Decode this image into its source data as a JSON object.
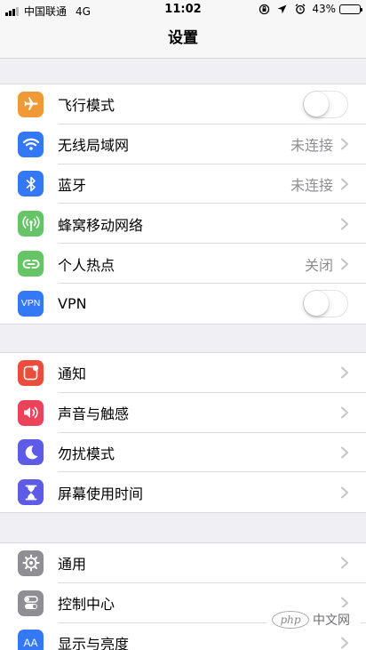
{
  "status_bar": {
    "carrier": "中国联通",
    "network": "4G",
    "time": "11:02",
    "battery_percent": "43%",
    "battery_level": 0.43,
    "icons": [
      "orientation-lock-icon",
      "location-arrow-icon",
      "alarm-clock-icon"
    ]
  },
  "nav": {
    "title": "设置"
  },
  "groups": [
    {
      "items": [
        {
          "label": "飞行模式",
          "icon": "airplane-icon",
          "color": "#f09a37",
          "control": "toggle",
          "on": false
        },
        {
          "label": "无线局域网",
          "icon": "wifi-icon",
          "color": "#3478f6",
          "value": "未连接",
          "control": "chevron"
        },
        {
          "label": "蓝牙",
          "icon": "bluetooth-icon",
          "color": "#3478f6",
          "value": "未连接",
          "control": "chevron"
        },
        {
          "label": "蜂窝移动网络",
          "icon": "cellular-antenna-icon",
          "color": "#65c466",
          "control": "chevron"
        },
        {
          "label": "个人热点",
          "icon": "hotspot-link-icon",
          "color": "#65c466",
          "value": "关闭",
          "control": "chevron"
        },
        {
          "label": "VPN",
          "icon": "vpn-icon",
          "icon_text": "VPN",
          "color": "#3478f6",
          "control": "toggle",
          "on": false
        }
      ]
    },
    {
      "items": [
        {
          "label": "通知",
          "icon": "notifications-icon",
          "color": "#eb4d3d",
          "control": "chevron"
        },
        {
          "label": "声音与触感",
          "icon": "speaker-icon",
          "color": "#eb445a",
          "control": "chevron"
        },
        {
          "label": "勿扰模式",
          "icon": "moon-icon",
          "color": "#5e5ce6",
          "control": "chevron"
        },
        {
          "label": "屏幕使用时间",
          "icon": "hourglass-icon",
          "color": "#5e5ce6",
          "control": "chevron"
        }
      ]
    },
    {
      "items": [
        {
          "label": "通用",
          "icon": "gear-icon",
          "color": "#8e8e93",
          "control": "chevron"
        },
        {
          "label": "控制中心",
          "icon": "control-center-toggles-icon",
          "color": "#8e8e93",
          "control": "chevron"
        },
        {
          "label": "显示与亮度",
          "icon": "text-size-icon",
          "icon_text": "AA",
          "color": "#3478f6",
          "control": "chevron"
        }
      ]
    }
  ],
  "watermark": {
    "logo_text": "php",
    "text": "中文网"
  }
}
